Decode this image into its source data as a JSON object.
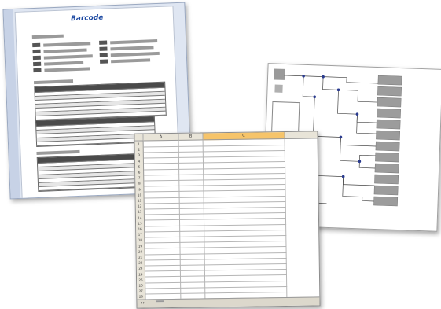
{
  "document": {
    "logo": "Barcode",
    "colors": {
      "accent": "#1c49a2",
      "dark": "#4a4a4a"
    }
  },
  "spreadsheet": {
    "columns": [
      "",
      "A",
      "B",
      "C"
    ],
    "title_cell": "",
    "rows": [
      [
        "",
        "",
        ""
      ],
      [
        "",
        "",
        ""
      ],
      [
        "",
        "",
        ""
      ],
      [
        "",
        "",
        ""
      ],
      [
        "",
        "",
        ""
      ],
      [
        "",
        "",
        ""
      ],
      [
        "",
        "",
        ""
      ],
      [
        "",
        "",
        ""
      ],
      [
        "",
        "",
        ""
      ],
      [
        "",
        "",
        ""
      ],
      [
        "",
        "",
        ""
      ],
      [
        "",
        "",
        ""
      ],
      [
        "",
        "",
        ""
      ],
      [
        "",
        "",
        ""
      ],
      [
        "",
        "",
        ""
      ],
      [
        "",
        "",
        ""
      ],
      [
        "",
        "",
        ""
      ],
      [
        "",
        "",
        ""
      ],
      [
        "",
        "",
        ""
      ],
      [
        "",
        "",
        ""
      ],
      [
        "",
        "",
        ""
      ],
      [
        "",
        "",
        ""
      ],
      [
        "",
        "",
        ""
      ],
      [
        "",
        "",
        ""
      ],
      [
        "",
        "",
        ""
      ],
      [
        "",
        "",
        ""
      ],
      [
        "",
        "",
        ""
      ],
      [
        "",
        "",
        ""
      ]
    ],
    "sheet_tab": ""
  }
}
